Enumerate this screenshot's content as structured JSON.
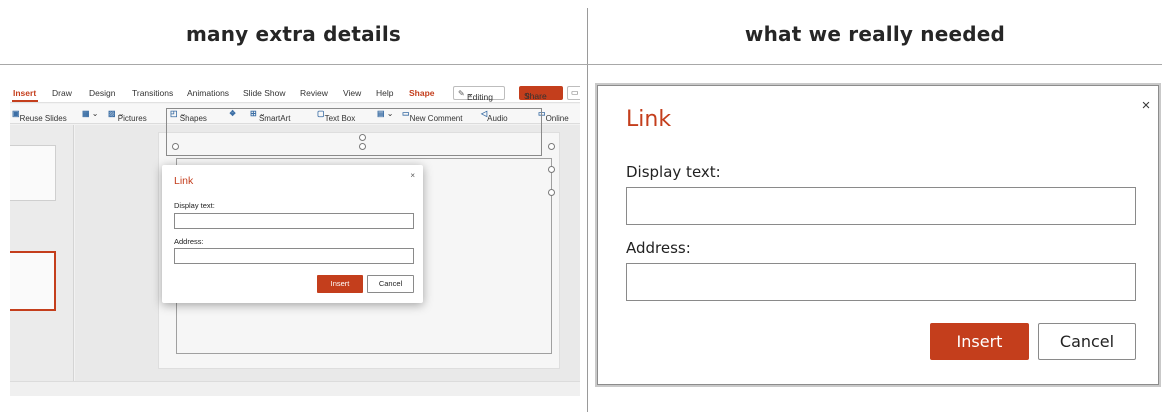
{
  "columns": {
    "left_title": "many extra details",
    "right_title": "what we really needed"
  },
  "ppt": {
    "tabs": [
      "Insert",
      "Draw",
      "Design",
      "Transitions",
      "Animations",
      "Slide Show",
      "Review",
      "View",
      "Help",
      "Shape"
    ],
    "editing_label": "Editing",
    "share_label": "Share",
    "commands": {
      "reuse_slides": "Reuse Slides",
      "pictures": "Pictures",
      "shapes": "Shapes",
      "smartart": "SmartArt",
      "text_box": "Text Box",
      "new_comment": "New Comment",
      "audio": "Audio",
      "online": "Online"
    }
  },
  "dialog": {
    "title": "Link",
    "close_glyph": "×",
    "display_text_label": "Display text:",
    "display_text_value": "",
    "address_label": "Address:",
    "address_value": "",
    "insert_label": "Insert",
    "cancel_label": "Cancel"
  },
  "colors": {
    "accent": "#c43e1c",
    "border": "#8a8a8a"
  }
}
